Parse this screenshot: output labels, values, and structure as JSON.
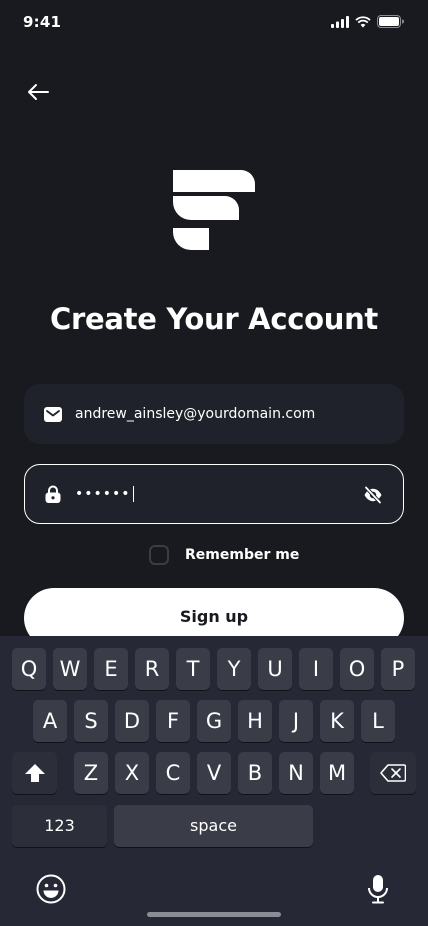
{
  "status_bar": {
    "time": "9:41"
  },
  "header": {
    "back_icon": "arrow-left-icon"
  },
  "logo": {
    "icon": "brand-logo"
  },
  "title": "Create Your Account",
  "form": {
    "email": {
      "value": "andrew_ainsley@yourdomain.com",
      "icon": "mail-icon"
    },
    "password": {
      "value": "••••••",
      "icon": "lock-icon",
      "toggle_icon": "eye-off-icon"
    },
    "remember_label": "Remember me",
    "remember_checked": false,
    "submit_label": "Sign up"
  },
  "keyboard": {
    "row1": [
      "Q",
      "W",
      "E",
      "R",
      "T",
      "Y",
      "U",
      "I",
      "O",
      "P"
    ],
    "row2": [
      "A",
      "S",
      "D",
      "F",
      "G",
      "H",
      "J",
      "K",
      "L"
    ],
    "row3": [
      "Z",
      "X",
      "C",
      "V",
      "B",
      "N",
      "M"
    ],
    "numbers_label": "123",
    "space_label": "space",
    "shift_icon": "shift-icon",
    "backspace_icon": "backspace-icon",
    "emoji_icon": "emoji-icon",
    "mic_icon": "mic-icon"
  },
  "colors": {
    "background": "#181a20",
    "field": "#1f222a",
    "keyboard": "#262935",
    "key": "#3a3d48",
    "button": "#ffffff"
  }
}
